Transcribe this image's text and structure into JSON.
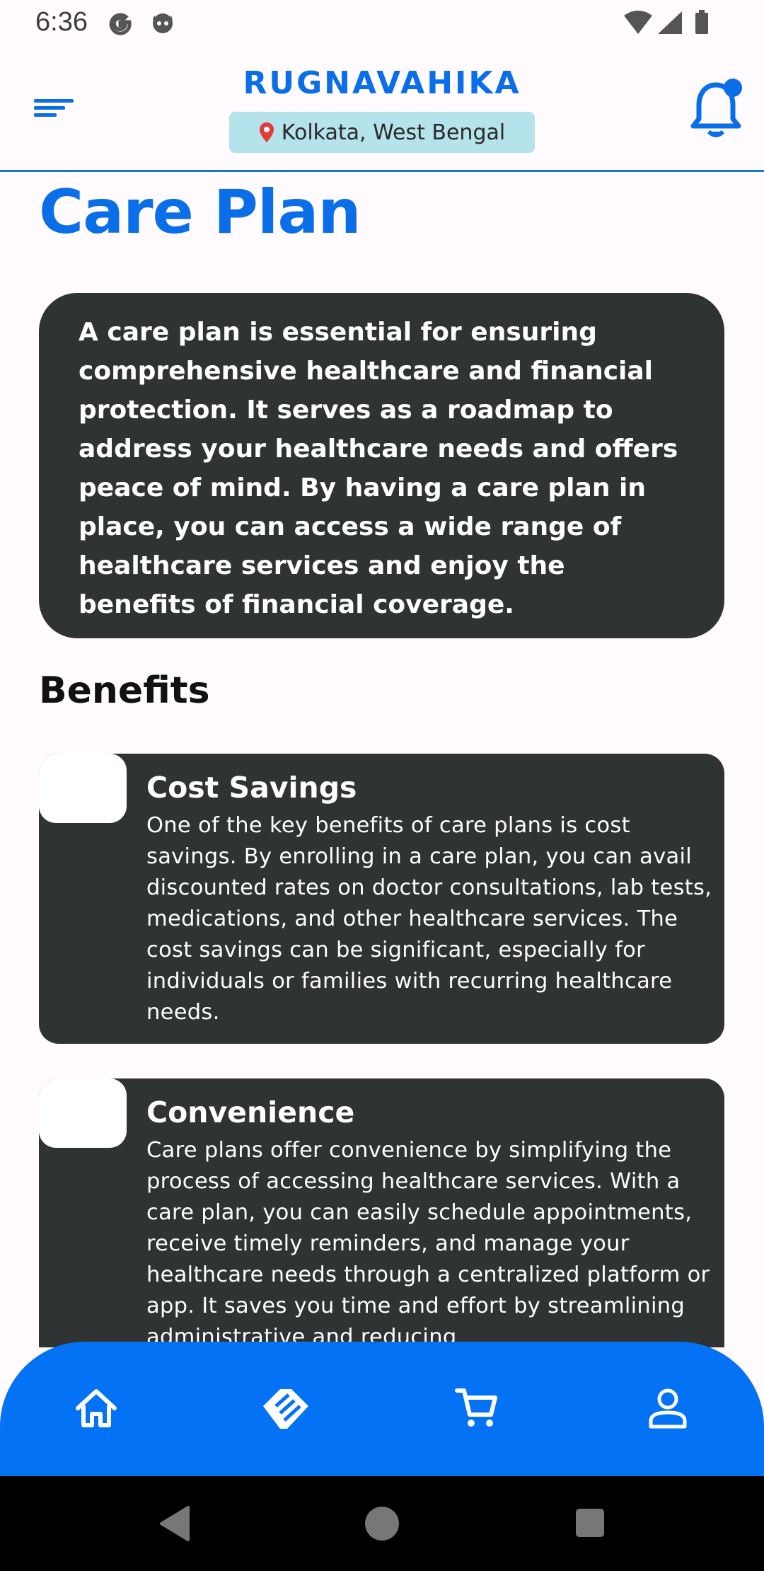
{
  "status_bar": {
    "time": "6:36",
    "left_icons": [
      "google-icon",
      "cat-icon"
    ],
    "right_icons": [
      "wifi-icon",
      "signal-icon",
      "battery-icon"
    ]
  },
  "header": {
    "brand": "RUGNAVAHIKA",
    "location": "Kolkata, West Bengal",
    "accent_color": "#0a6ee9",
    "pill_color": "#b5e3ec"
  },
  "page": {
    "title": "Care Plan",
    "intro": "A care plan is essential for ensuring comprehensive healthcare and financial protection. It serves as a roadmap to address your healthcare needs and offers peace of mind. By having a care plan in place, you can access a wide range of healthcare services and enjoy the benefits of financial coverage.",
    "benefits_title": "Benefits",
    "benefits": [
      {
        "title": "Cost Savings",
        "text": "One of the key benefits of care plans is cost savings. By enrolling in a care plan, you can avail discounted rates on doctor consultations, lab tests, medications, and other healthcare services. The cost savings can be significant, especially for individuals or families with recurring healthcare needs."
      },
      {
        "title": "Convenience",
        "text": "Care plans offer convenience by simplifying the process of accessing healthcare services. With a care plan, you can easily schedule appointments, receive timely reminders, and manage your healthcare needs through a centralized platform or app. It saves you time and effort by streamlining administrative and reducing"
      }
    ]
  },
  "bottom_nav": {
    "color": "#0472f5",
    "items": [
      "home-icon",
      "care-plan-icon",
      "cart-icon",
      "profile-icon"
    ]
  },
  "system_nav": [
    "back-icon",
    "home-circle-icon",
    "recents-icon"
  ]
}
